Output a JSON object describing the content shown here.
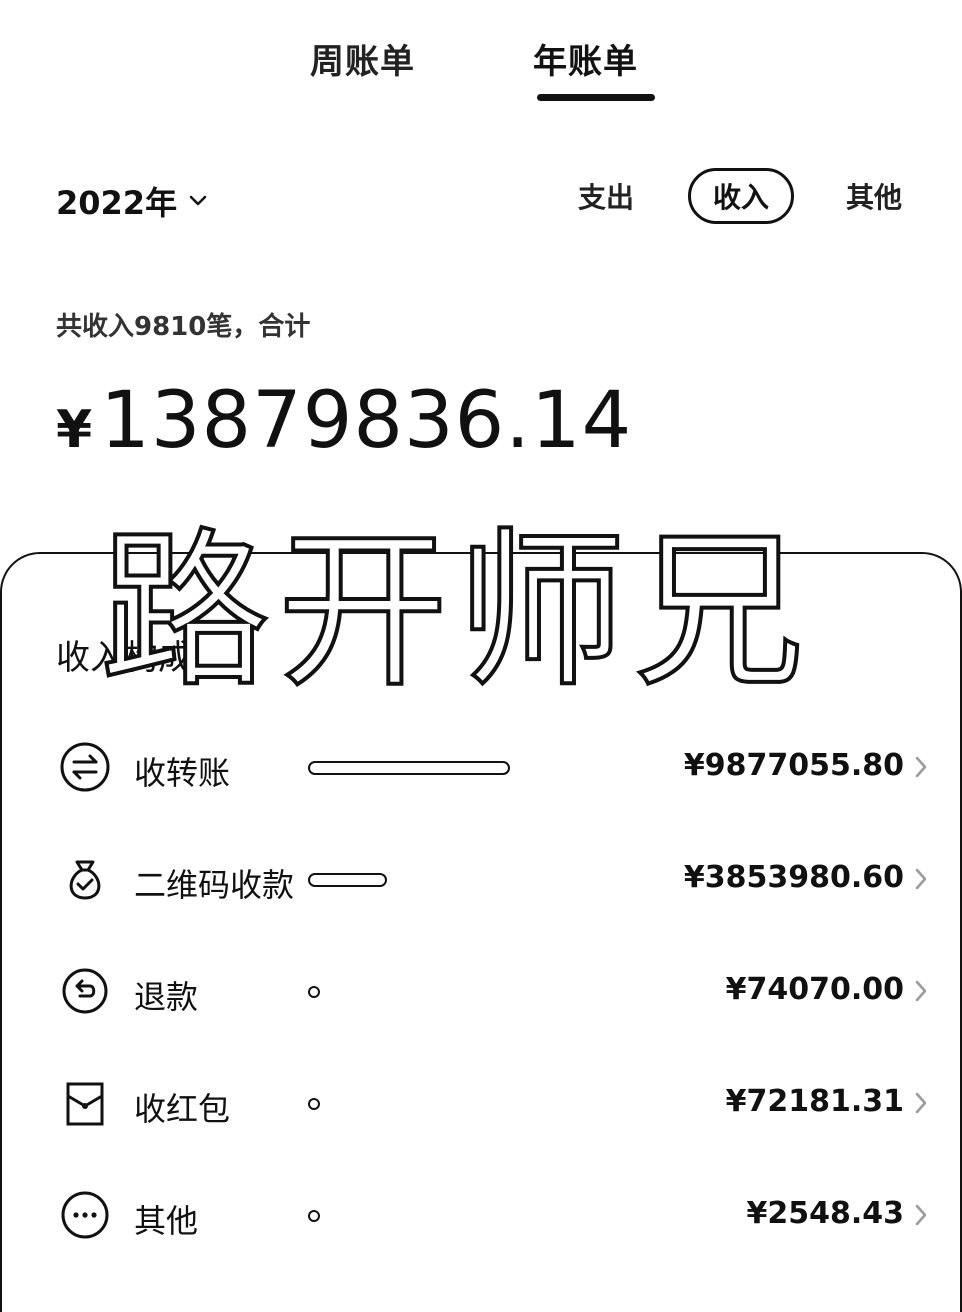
{
  "tabs": {
    "weekly": "周账单",
    "yearly": "年账单"
  },
  "filter": {
    "year": "2022年",
    "expense": "支出",
    "income": "收入",
    "other": "其他"
  },
  "summary": {
    "text": "共收入9810笔，合计",
    "currency": "¥",
    "total": "13879836.14"
  },
  "watermark": "路开师兄",
  "card": {
    "title": "收入构成"
  },
  "breakdown": [
    {
      "label": "收转账",
      "amount": "¥9877055.80",
      "value": 9877055.8,
      "icon": "transfer-icon"
    },
    {
      "label": "二维码收款",
      "amount": "¥3853980.60",
      "value": 3853980.6,
      "icon": "money-bag-icon"
    },
    {
      "label": "退款",
      "amount": "¥74070.00",
      "value": 74070.0,
      "icon": "refund-icon"
    },
    {
      "label": "收红包",
      "amount": "¥72181.31",
      "value": 72181.31,
      "icon": "red-packet-icon"
    },
    {
      "label": "其他",
      "amount": "¥2548.43",
      "value": 2548.43,
      "icon": "more-icon"
    }
  ]
}
